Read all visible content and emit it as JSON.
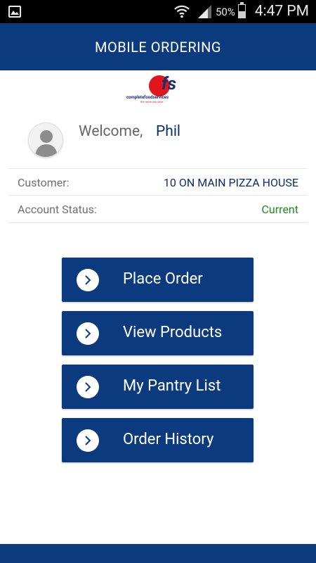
{
  "status_bar": {
    "battery_percent": "50%",
    "time": "4:47 PM"
  },
  "header": {
    "title": "MOBILE ORDERING"
  },
  "logo": {
    "brand_mark": "fs",
    "company_name": "completefoodservices",
    "tagline": "the more you save"
  },
  "welcome": {
    "label": "Welcome,",
    "name": "Phil"
  },
  "account": {
    "customer_label": "Customer:",
    "customer_value": "10 ON MAIN PIZZA HOUSE",
    "status_label": "Account Status:",
    "status_value": "Current"
  },
  "menu": [
    {
      "label": "Place Order"
    },
    {
      "label": "View Products"
    },
    {
      "label": "My Pantry List"
    },
    {
      "label": "Order History"
    }
  ],
  "colors": {
    "primary": "#0b3a7e",
    "name_text": "#0b2d6b",
    "status_current": "#1e8a1e",
    "logo_red": "#e1161c"
  }
}
